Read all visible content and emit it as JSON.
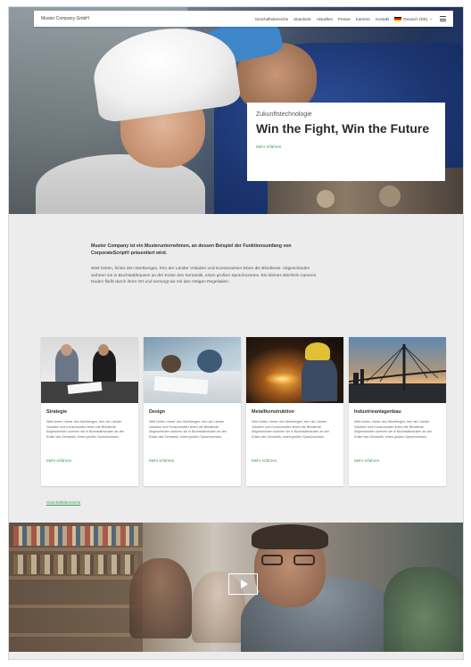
{
  "nav": {
    "brand": "Muster Company GmbH",
    "items": [
      "Geschäftsbereiche",
      "Standorte",
      "Aktuelles",
      "Presse",
      "Karriere",
      "Kontakt"
    ],
    "language": "Deutsch (DE)"
  },
  "hero": {
    "eyebrow": "Zukunftstechnologie",
    "headline": "Win the Fight, Win the Future",
    "more": "Mehr erfahren"
  },
  "intro": {
    "lead": "Muster Company ist ein Musterunternehmen, an dessen Beispiel der Funktionsumfang von CorporateScript® präsentiert wird.",
    "body": "Weit hinten, hinter den Wortbergen, fern der Länder Vokalien und Konsonantien leben die Blindtexte. Abgeschieden wohnen sie in Buchstabhausen an der Küste des Semantik, eines großen Sprachozeans. Ein kleines Bächlein namens Duden fließt durch ihren Ort und versorgt sie mit den nötigen Regelialien."
  },
  "cards": [
    {
      "title": "Strategie",
      "text": "Weit hinten, hinter den Wortbergen, fern der Länder Vokalien und Konsonantien leben die Blindtexte. Abgeschieden wohnen sie in Buchstabhausen an der Küste des Semantik, eines großen Sprachozeans.",
      "link": "Mehr erfahren"
    },
    {
      "title": "Design",
      "text": "Weit hinten, hinter den Wortbergen, fern der Länder Vokalien und Konsonantien leben die Blindtexte. Abgeschieden wohnen sie in Buchstabhausen an der Küste des Semantik, eines großen Sprachozeans.",
      "link": "Mehr erfahren"
    },
    {
      "title": "Metallkonstruktion",
      "text": "Weit hinten, hinter den Wortbergen, fern der Länder Vokalien und Konsonantien leben die Blindtexte. Abgeschieden wohnen sie in Buchstabhausen an der Küste des Semantik, eines großen Sprachozeans.",
      "link": "Mehr erfahren"
    },
    {
      "title": "Industrieanlagenbau",
      "text": "Weit hinten, hinter den Wortbergen, fern der Länder Vokalien und Konsonantien leben die Blindtexte. Abgeschieden wohnen sie in Buchstabhausen an der Küste des Semantik, eines großen Sprachozeans.",
      "link": "Mehr erfahren"
    }
  ],
  "all_link": "Geschäftsbereiche",
  "colors": {
    "accent_green": "#3a9d55",
    "page_bg": "#ececec",
    "card_bg": "#ffffff"
  },
  "icons": {
    "menu": "hamburger-menu-icon",
    "flag": "germany-flag-icon",
    "play": "play-icon"
  }
}
